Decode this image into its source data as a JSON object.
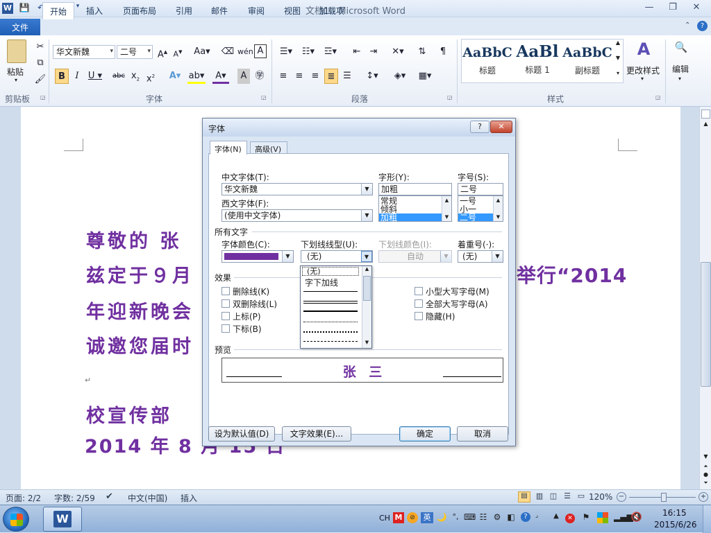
{
  "window": {
    "title": "文档1 - Microsoft Word",
    "minimize": "—",
    "maximize": "❐",
    "close": "✕"
  },
  "ribbon_tabs": [
    "文件",
    "开始",
    "插入",
    "页面布局",
    "引用",
    "邮件",
    "审阅",
    "视图",
    "加载项"
  ],
  "ribbon": {
    "paste_label": "粘贴",
    "font_name": "华文新魏",
    "font_size": "二号",
    "styles": [
      {
        "preview": "AaBbC",
        "label": "标题"
      },
      {
        "preview": "AaBl",
        "label": "标题 1"
      },
      {
        "preview": "AaBbC",
        "label": "副标题"
      }
    ],
    "change_styles": "更改样式",
    "edit": "编辑",
    "groups": {
      "clipboard": "剪贴板",
      "font": "字体",
      "paragraph": "段落",
      "styles": "样式"
    }
  },
  "document": {
    "lines": [
      "尊敬的 张",
      "兹定于９月",
      "年迎新晚会",
      "诚邀您届时",
      "",
      "校宣传部",
      "2014 年 8 月 15 日"
    ],
    "right_fragment": "举行“2014",
    "para_mark": "↵"
  },
  "dialog": {
    "title": "字体",
    "help": "?",
    "close": "✕",
    "tabs": [
      "字体(N)",
      "高级(V)"
    ],
    "chinese_font_label": "中文字体(T):",
    "chinese_font_value": "华文新魏",
    "western_font_label": "西文字体(F):",
    "western_font_value": "(使用中文字体)",
    "style_label": "字形(Y):",
    "style_value": "加粗",
    "style_options": [
      "常规",
      "倾斜",
      "加粗"
    ],
    "size_label": "字号(S):",
    "size_value": "二号",
    "size_options": [
      "一号",
      "小一",
      "二号"
    ],
    "all_text_label": "所有文字",
    "font_color_label": "字体颜色(C):",
    "font_color_value": "#7030a0",
    "underline_style_label": "下划线线型(U):",
    "underline_style_value": "(无)",
    "underline_options": [
      "(无)",
      "字下加线"
    ],
    "underline_color_label": "下划线颜色(I):",
    "underline_color_value": "自动",
    "emphasis_label": "着重号(·):",
    "emphasis_value": "(无)",
    "effects_label": "效果",
    "effects_left": [
      "删除线(K)",
      "双删除线(L)",
      "上标(P)",
      "下标(B)"
    ],
    "effects_right": [
      "小型大写字母(M)",
      "全部大写字母(A)",
      "隐藏(H)"
    ],
    "preview_label": "预览",
    "preview_text": "张 三",
    "set_default": "设为默认值(D)",
    "text_effects": "文字效果(E)...",
    "ok": "确定",
    "cancel": "取消"
  },
  "status": {
    "page": "页面: 2/2",
    "words": "字数: 2/59",
    "language": "中文(中国)",
    "mode": "插入",
    "zoom": "120%"
  },
  "taskbar": {
    "lang": "CH",
    "time": "16:15",
    "date": "2015/6/26"
  },
  "colors": {
    "doc_text": "#7030a0",
    "accent": "#2b579a"
  }
}
